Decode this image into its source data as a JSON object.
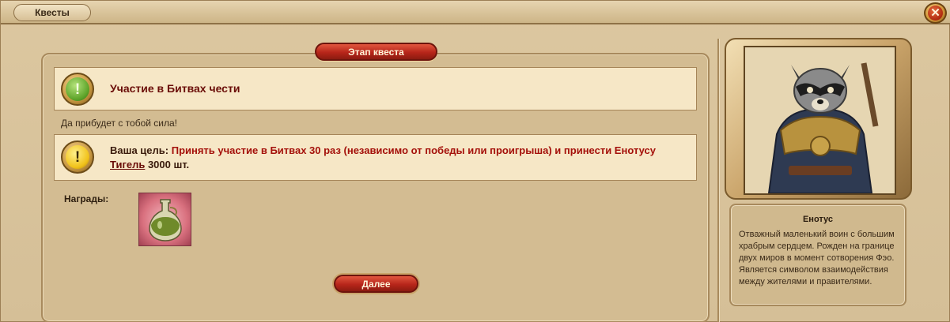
{
  "window": {
    "tab_label": "Квесты",
    "close_icon": "close-icon"
  },
  "quest": {
    "stage_label": "Этап квеста",
    "title": "Участие в Битвах чести",
    "subtitle": "Да прибудет с тобой сила!",
    "goal": {
      "prefix": "Ваша цель: ",
      "text": "Принять участие в Битвах 30 раз (независимо от победы или проигрыша) и принести Енотусу ",
      "item": "Тигель",
      "amount": " 3000 шт."
    },
    "rewards_label": "Награды:",
    "reward_icon": "potion-flask-icon",
    "next_button": "Далее"
  },
  "npc": {
    "name": "Енотус",
    "description": "Отважный маленький воин с большим храбрым сердцем. Рожден на границе двух миров в момент сотворения Фэо. Является символом взаимодействия между жителями и правителями."
  },
  "colors": {
    "accent_red": "#b7261a",
    "title_dark_red": "#6a0d08",
    "goal_red": "#a4100a",
    "parchment": "#f6e7c6"
  }
}
